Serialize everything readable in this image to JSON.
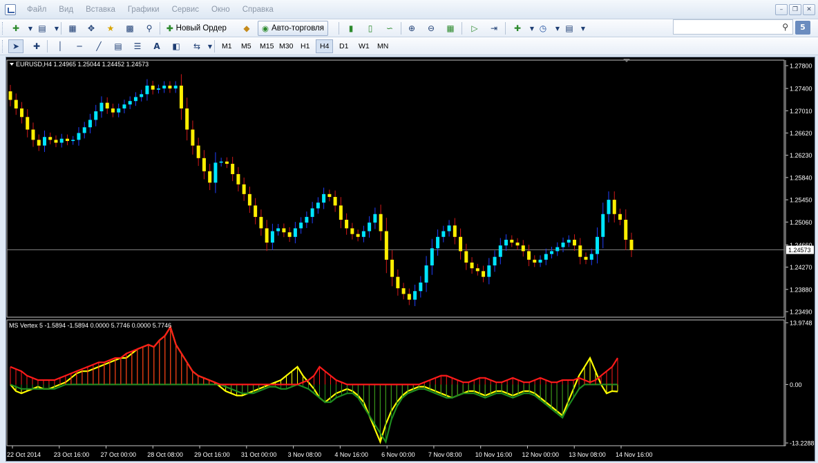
{
  "menu": {
    "items": [
      "Файл",
      "Вид",
      "Вставка",
      "Графики",
      "Сервис",
      "Окно",
      "Справка"
    ]
  },
  "toolbar": {
    "new_order_label": "Новый Ордер",
    "autotrade_label": "Авто-торговля",
    "search_placeholder": "",
    "notification_count": "5",
    "timeframes": [
      "M1",
      "M5",
      "M15",
      "M30",
      "H1",
      "H4",
      "D1",
      "W1",
      "MN"
    ],
    "active_timeframe": "H4"
  },
  "chart_data": [
    {
      "type": "candlestick",
      "header": "EURUSD,H4  1.24965 1.25044 1.24452 1.24573",
      "symbol": "EURUSD",
      "timeframe": "H4",
      "ohlc_current": [
        1.24965,
        1.25044,
        1.24452,
        1.24573
      ],
      "price_ticks": [
        "1.27800",
        "1.27400",
        "1.27010",
        "1.26620",
        "1.26230",
        "1.25840",
        "1.25450",
        "1.25060",
        "1.24660",
        "1.24270",
        "1.23880",
        "1.23490"
      ],
      "ylim": [
        1.2349,
        1.278
      ],
      "current_price": "1.24573",
      "colors": {
        "bull": "#00e5ff",
        "bear": "#ffee00",
        "wick_bull": "#2040ff",
        "wick_bear": "#d01818",
        "background": "#000000",
        "price_line": "#7f7f7f"
      },
      "closes": [
        1.272,
        1.2705,
        1.269,
        1.2668,
        1.265,
        1.264,
        1.2655,
        1.265,
        1.2645,
        1.2652,
        1.2648,
        1.265,
        1.2662,
        1.2672,
        1.2685,
        1.27,
        1.2715,
        1.2705,
        1.2698,
        1.2705,
        1.2712,
        1.2718,
        1.2725,
        1.273,
        1.2745,
        1.2738,
        1.274,
        1.2745,
        1.274,
        1.2745,
        1.2705,
        1.2668,
        1.264,
        1.2618,
        1.2595,
        1.2575,
        1.261,
        1.2612,
        1.2608,
        1.259,
        1.2572,
        1.2555,
        1.2535,
        1.2515,
        1.2495,
        1.247,
        1.249,
        1.2495,
        1.2488,
        1.248,
        1.2495,
        1.2505,
        1.2515,
        1.253,
        1.254,
        1.2555,
        1.255,
        1.2535,
        1.251,
        1.2495,
        1.2485,
        1.248,
        1.249,
        1.2505,
        1.252,
        1.249,
        1.244,
        1.241,
        1.239,
        1.238,
        1.237,
        1.2385,
        1.24,
        1.243,
        1.246,
        1.248,
        1.249,
        1.25,
        1.248,
        1.2455,
        1.2435,
        1.2425,
        1.242,
        1.241,
        1.243,
        1.2445,
        1.2465,
        1.2475,
        1.247,
        1.2465,
        1.2455,
        1.244,
        1.2435,
        1.244,
        1.245,
        1.2455,
        1.2462,
        1.247,
        1.2475,
        1.2465,
        1.2445,
        1.244,
        1.245,
        1.248,
        1.252,
        1.2545,
        1.252,
        1.251,
        1.2475,
        1.2457
      ],
      "date_labels": [
        "22 Oct 2014",
        "23 Oct 16:00",
        "27 Oct 00:00",
        "28 Oct 08:00",
        "29 Oct 16:00",
        "31 Oct 00:00",
        "3 Nov 08:00",
        "4 Nov 16:00",
        "6 Nov 00:00",
        "7 Nov 08:00",
        "10 Nov 16:00",
        "12 Nov 00:00",
        "13 Nov 08:00",
        "14 Nov 16:00"
      ]
    },
    {
      "type": "line",
      "header": "MS Vertex 5 -1.5894 -1.5894 0.0000 5.7746 0.0000 5.7746",
      "indicator": "MS Vertex 5",
      "values_header": [
        -1.5894,
        -1.5894,
        0.0,
        5.7746,
        0.0,
        5.7746
      ],
      "y_ticks": [
        "13.9748",
        "0.00",
        "-13.2288"
      ],
      "ylim": [
        -13.2288,
        13.9748
      ],
      "series": [
        {
          "name": "",
          "color": "#ff1a1a",
          "values": [
            4,
            3.5,
            3,
            2,
            1.5,
            1,
            1,
            1,
            1,
            1.5,
            2,
            2.5,
            3,
            3.5,
            4,
            4.5,
            5,
            5,
            5.5,
            6,
            6,
            7,
            7.5,
            8,
            8.5,
            9,
            8.5,
            10,
            11,
            13,
            9,
            7,
            5,
            3,
            2,
            1.5,
            1,
            0.5,
            0,
            0,
            0,
            0,
            0,
            0,
            0,
            0,
            0,
            0,
            0,
            0,
            0,
            0,
            0,
            0.5,
            1,
            2,
            4,
            3,
            2,
            1,
            0.5,
            0,
            0,
            0,
            0,
            0,
            0,
            0,
            0,
            0,
            0,
            0,
            0,
            0,
            0,
            0.5,
            1,
            1.5,
            2,
            2,
            1.5,
            1,
            0.5,
            0.5,
            1,
            1.5,
            1.5,
            1,
            0.5,
            0.5,
            1,
            1.5,
            1,
            0.5,
            0.5,
            1,
            1.5,
            1,
            0.5,
            0.5,
            1,
            1,
            1,
            1.5,
            1,
            0.5,
            1,
            2,
            3,
            4,
            6
          ]
        },
        {
          "name": "",
          "color": "#ffff00",
          "values": [
            0,
            -1.5,
            -2,
            -1.5,
            -1,
            -0.5,
            -1,
            -1,
            -0.5,
            0,
            0.5,
            1.5,
            2.5,
            3,
            3,
            3.5,
            4,
            4.5,
            5,
            5.5,
            6,
            6,
            7,
            8,
            8.5,
            9,
            8.5,
            10,
            11,
            13,
            9,
            7,
            5,
            3,
            2,
            1.5,
            1,
            0.5,
            -0.5,
            -1.5,
            -2,
            -2.5,
            -2.5,
            -2,
            -1.5,
            -1,
            -0.5,
            0,
            0.5,
            1,
            2,
            3,
            4,
            2,
            0.5,
            -1,
            -3,
            -4,
            -3,
            -2,
            -1.5,
            -1,
            -1.5,
            -2.5,
            -4,
            -7,
            -10,
            -13,
            -9,
            -6,
            -4,
            -2.5,
            -1.5,
            -1,
            -0.5,
            -0.5,
            -1,
            -1.5,
            -2,
            -2.5,
            -3,
            -2.5,
            -2,
            -1.5,
            -1.5,
            -2,
            -2.5,
            -2,
            -1.5,
            -1.5,
            -2,
            -2.5,
            -2,
            -1.5,
            -1.5,
            -2,
            -3,
            -4,
            -5,
            -6,
            -7,
            -4,
            -1,
            2,
            4,
            6,
            3,
            0,
            -2,
            -1.5,
            -1.6
          ]
        },
        {
          "name": "",
          "color": "#1f8c1f",
          "values": [
            0,
            -0.5,
            -1,
            -1,
            -1,
            -1,
            -1,
            -1,
            -1,
            -0.5,
            0,
            0,
            0,
            0,
            0,
            0,
            0,
            0,
            0,
            0,
            0,
            0,
            0,
            0,
            0,
            0,
            0,
            0,
            0,
            0,
            0,
            0,
            0,
            0,
            0,
            0,
            0,
            0,
            0,
            -0.5,
            -1,
            -1.5,
            -2,
            -2,
            -2,
            -1.5,
            -1,
            -0.5,
            -0.5,
            -1,
            -1,
            -0.5,
            0,
            -0.5,
            -1,
            -2,
            -3,
            -4,
            -4,
            -3,
            -2.5,
            -2,
            -2,
            -3,
            -5,
            -7,
            -9,
            -11,
            -13,
            -8,
            -5,
            -3,
            -2,
            -1.5,
            -1,
            -1,
            -1.5,
            -2,
            -2.5,
            -3,
            -3,
            -2.5,
            -2,
            -2,
            -2,
            -2.5,
            -3,
            -2.5,
            -2,
            -2,
            -2.5,
            -3,
            -2.5,
            -2,
            -2,
            -2.5,
            -3.5,
            -4.5,
            -5.5,
            -6.5,
            -7.5,
            -5,
            -3,
            -1,
            0,
            0,
            0,
            0,
            0,
            0,
            0
          ]
        }
      ]
    }
  ]
}
